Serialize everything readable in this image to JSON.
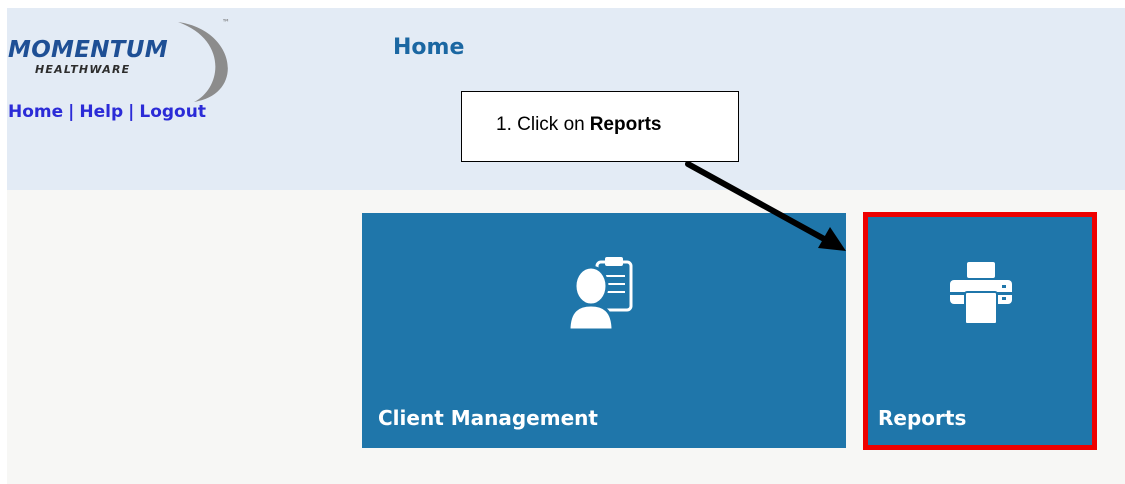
{
  "logo": {
    "word": "MOMENTUM",
    "sub": "HEALTHWARE",
    "tm": "™"
  },
  "top_nav": {
    "items": [
      "Home",
      "Help",
      "Logout"
    ],
    "separator": "|"
  },
  "page_title": "Home",
  "callout": {
    "prefix": "1. Click on",
    "emphasis": "Reports"
  },
  "tiles": [
    {
      "label": "Client Management",
      "icon": "client-clipboard-icon"
    },
    {
      "label": "Reports",
      "icon": "printer-icon"
    }
  ],
  "colors": {
    "header_bg": "#e3ebf5",
    "content_bg": "#f7f7f5",
    "tile_bg": "#1f76aa",
    "title": "#1b67a2",
    "nav_link": "#2b2bd7",
    "highlight_border": "#ee0000",
    "logo_blue": "#1e4f95"
  }
}
